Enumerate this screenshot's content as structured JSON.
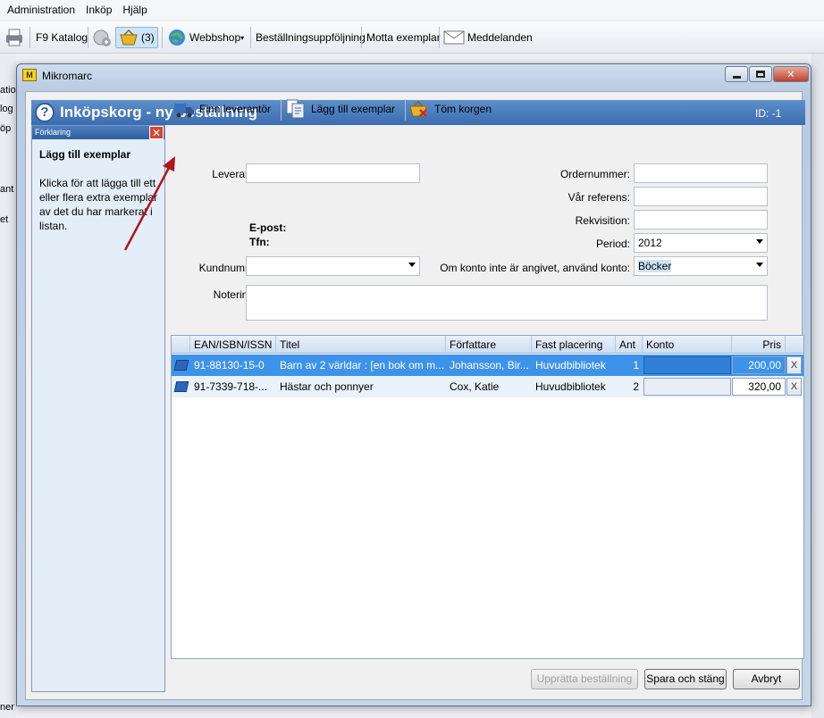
{
  "menubar": {
    "items": [
      "Administration",
      "Inköp",
      "Hjälp"
    ]
  },
  "main_toolbar": {
    "katalog": "F9 Katalog",
    "basket_count": "(3)",
    "webbshop": "Webbshop",
    "bestallning": "Beställningsuppföljning",
    "motta": "Motta exemplar",
    "meddelanden": "Meddelanden"
  },
  "bg_left": [
    "atio",
    "log",
    "öp",
    "ant",
    "et",
    "ner"
  ],
  "window": {
    "title": "Mikromarc",
    "app_icon_text": "M"
  },
  "header": {
    "title": "Inköpskorg - ny beställning",
    "id": "ID: -1",
    "help_glyph": "?"
  },
  "explain": {
    "header": "Förklaring",
    "close": "✕",
    "title": "Lägg till exemplar",
    "text": "Klicka för att lägga till ett eller flera extra exemplar av det du har markerat i listan."
  },
  "actions": {
    "finn": "Finn leverantör",
    "lagg": "Lägg till exemplar",
    "tom": "Töm korgen"
  },
  "form": {
    "leverantor_label": "Leverantör:",
    "leverantor_value": "",
    "epost_label": "E-post:",
    "tfn_label": "Tfn:",
    "kundnummer_label": "Kundnummer:",
    "kundnummer_value": "",
    "noteringar_label": "Noteringar:",
    "noteringar_value": "",
    "ordernummer_label": "Ordernummer:",
    "ordernummer_value": "",
    "var_referens_label": "Vår referens:",
    "var_referens_value": "",
    "rekvisition_label": "Rekvisition:",
    "rekvisition_value": "",
    "period_label": "Period:",
    "period_value": "2012",
    "konto_label": "Om konto inte är angivet, använd konto:",
    "konto_value": "Böcker"
  },
  "table": {
    "headers": [
      "EAN/ISBN/ISSN",
      "Titel",
      "Författare",
      "Fast placering",
      "Ant",
      "Konto",
      "Pris"
    ],
    "rows": [
      {
        "ean": "91-88130-15-0",
        "titel": "Barn av 2 världar : [en bok om m...",
        "forfattare": "Johansson, Bir...",
        "placering": "Huvudbibliotek",
        "ant": "1",
        "konto": "",
        "pris": "200,00",
        "x": "X"
      },
      {
        "ean": "91-7339-718-...",
        "titel": "Hästar och ponnyer",
        "forfattare": "Cox, Katie",
        "placering": "Huvudbibliotek",
        "ant": "2",
        "konto": "",
        "pris": "320,00",
        "x": "X"
      }
    ]
  },
  "buttons": {
    "uppratta": "Upprätta beställning",
    "spara": "Spara och stäng",
    "avbryt": "Avbryt"
  },
  "colors": {
    "header": "#3a6db1",
    "selected_row": "#3d93ea",
    "arrow": "#b0141c"
  }
}
